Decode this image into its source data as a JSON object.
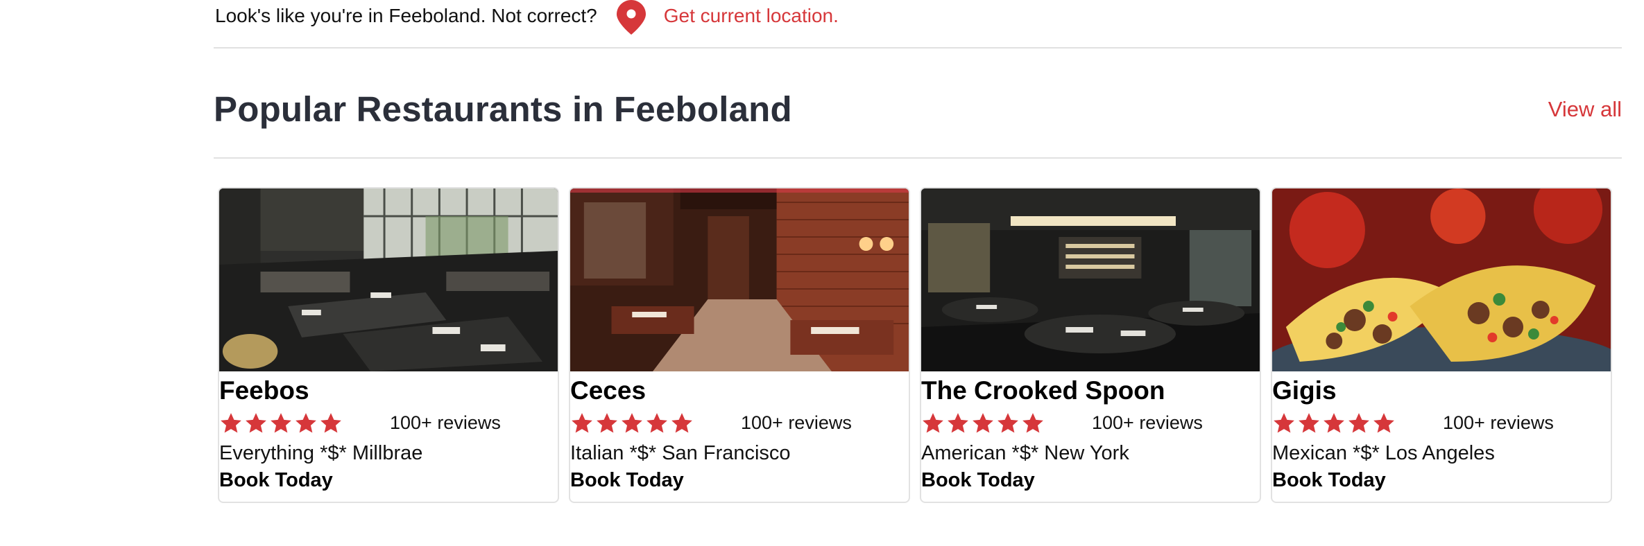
{
  "location_bar": {
    "message": "Look's like you're in Feeboland. Not correct?",
    "pin_icon": "map-pin-icon",
    "link": "Get current location.",
    "accent": "#d6373a"
  },
  "section": {
    "title": "Popular Restaurants in Feeboland",
    "view_all": "View all"
  },
  "restaurants": [
    {
      "name": "Feebos",
      "rating": 5,
      "reviews": "100+ reviews",
      "meta": "Everything *$* Millbrae",
      "cta": "Book Today",
      "image": "modern-dining-room-photo"
    },
    {
      "name": "Ceces",
      "rating": 5,
      "reviews": "100+ reviews",
      "meta": "Italian *$* San Francisco",
      "cta": "Book Today",
      "image": "brick-wall-dining-room-photo"
    },
    {
      "name": "The Crooked Spoon",
      "rating": 5,
      "reviews": "100+ reviews",
      "meta": "American *$* New York",
      "cta": "Book Today",
      "image": "dark-dining-room-photo"
    },
    {
      "name": "Gigis",
      "rating": 5,
      "reviews": "100+ reviews",
      "meta": "Mexican *$* Los Angeles",
      "cta": "Book Today",
      "image": "tacos-photo"
    }
  ],
  "colors": {
    "star": "#d6373a",
    "title": "#2b2f3a",
    "divider": "#e1e1e1"
  }
}
